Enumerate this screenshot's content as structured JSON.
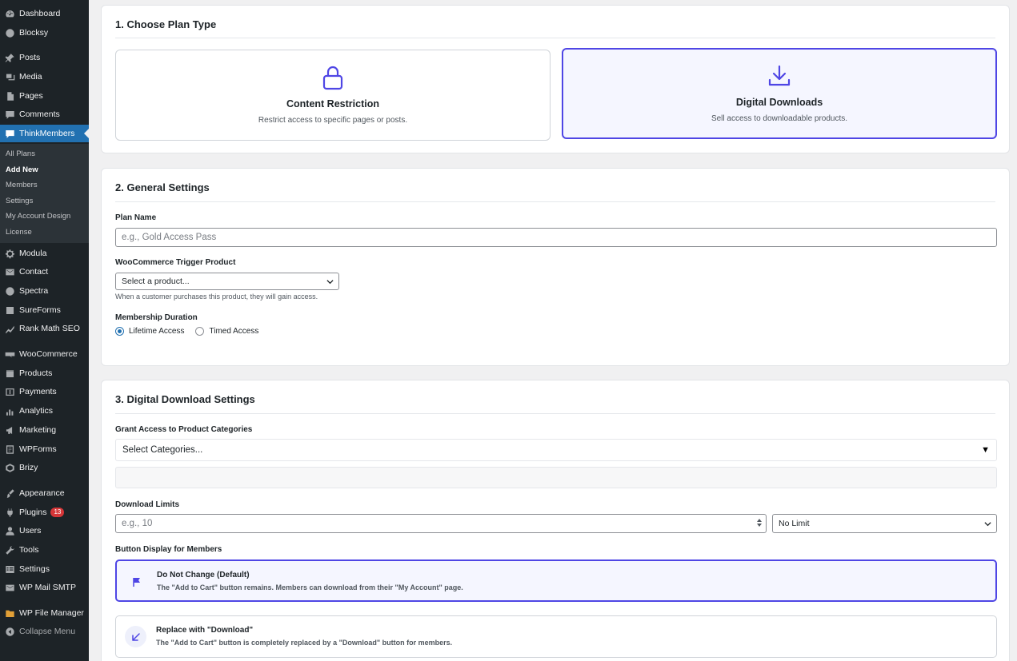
{
  "sidebar": {
    "items": [
      {
        "label": "Dashboard",
        "icon": "dashboard-icon"
      },
      {
        "label": "Blocksy",
        "icon": "blocksy-icon"
      },
      {
        "label": "Posts",
        "icon": "pin-icon"
      },
      {
        "label": "Media",
        "icon": "media-icon"
      },
      {
        "label": "Pages",
        "icon": "pages-icon"
      },
      {
        "label": "Comments",
        "icon": "comment-icon"
      },
      {
        "label": "ThinkMembers",
        "icon": "thinkmembers-icon"
      },
      {
        "label": "Modula",
        "icon": "gear-icon"
      },
      {
        "label": "Contact",
        "icon": "mail-icon"
      },
      {
        "label": "Spectra",
        "icon": "spectra-icon"
      },
      {
        "label": "SureForms",
        "icon": "sureforms-icon"
      },
      {
        "label": "Rank Math SEO",
        "icon": "rankmath-icon"
      },
      {
        "label": "WooCommerce",
        "icon": "woocommerce-icon"
      },
      {
        "label": "Products",
        "icon": "products-icon"
      },
      {
        "label": "Payments",
        "icon": "payments-icon"
      },
      {
        "label": "Analytics",
        "icon": "analytics-icon"
      },
      {
        "label": "Marketing",
        "icon": "megaphone-icon"
      },
      {
        "label": "WPForms",
        "icon": "wpforms-icon"
      },
      {
        "label": "Brizy",
        "icon": "brizy-icon"
      },
      {
        "label": "Appearance",
        "icon": "brush-icon"
      },
      {
        "label": "Plugins",
        "icon": "plugin-icon",
        "badge": "13"
      },
      {
        "label": "Users",
        "icon": "user-icon"
      },
      {
        "label": "Tools",
        "icon": "wrench-icon"
      },
      {
        "label": "Settings",
        "icon": "settings-icon"
      },
      {
        "label": "WP Mail SMTP",
        "icon": "mail-smtp-icon"
      },
      {
        "label": "WP File Manager",
        "icon": "folder-icon"
      },
      {
        "label": "Collapse Menu",
        "icon": "collapse-icon"
      }
    ],
    "submenu": [
      "All Plans",
      "Add New",
      "Members",
      "Settings",
      "My Account Design",
      "License"
    ]
  },
  "plan_type": {
    "title": "1. Choose Plan Type",
    "options": [
      {
        "title": "Content Restriction",
        "desc": "Restrict access to specific pages or posts.",
        "icon": "lock-icon"
      },
      {
        "title": "Digital Downloads",
        "desc": "Sell access to downloadable products.",
        "icon": "download-icon"
      }
    ]
  },
  "general": {
    "title": "2. General Settings",
    "plan_name_label": "Plan Name",
    "plan_name_placeholder": "e.g., Gold Access Pass",
    "trigger_label": "WooCommerce Trigger Product",
    "trigger_value": "Select a product...",
    "trigger_help": "When a customer purchases this product, they will gain access.",
    "duration_label": "Membership Duration",
    "duration_options": [
      "Lifetime Access",
      "Timed Access"
    ]
  },
  "downloads": {
    "title": "3. Digital Download Settings",
    "categories_label": "Grant Access to Product Categories",
    "categories_value": "Select Categories...",
    "limits_label": "Download Limits",
    "limits_placeholder": "e.g., 10",
    "limits_period": "No Limit",
    "button_display_label": "Button Display for Members",
    "button_options": [
      {
        "title": "Do Not Change (Default)",
        "desc": "The \"Add to Cart\" button remains. Members can download from their \"My Account\" page.",
        "icon": "flag-icon"
      },
      {
        "title": "Replace with \"Download\"",
        "desc": "The \"Add to Cart\" button is completely replaced by a \"Download\" button for members.",
        "icon": "arrow-down-left-icon"
      }
    ]
  },
  "colors": {
    "sidebar_bg": "#1d2327",
    "wp_blue": "#2271b1",
    "accent": "#4f46e5"
  }
}
